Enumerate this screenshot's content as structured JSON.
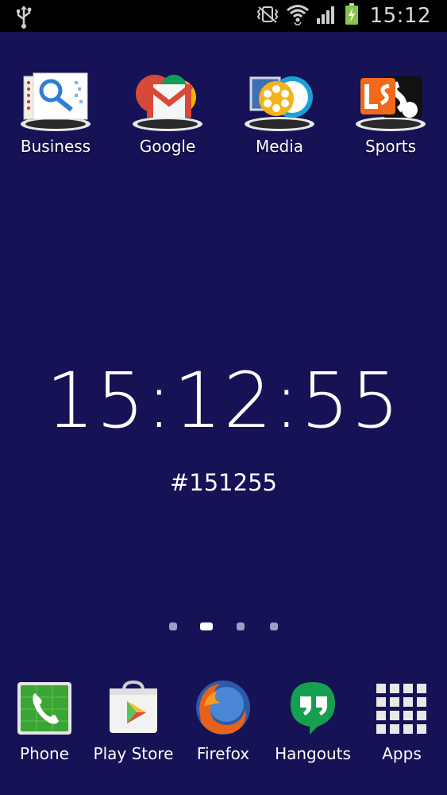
{
  "status_bar": {
    "time": "15:12",
    "icons": [
      "usb-icon",
      "vibrate-icon",
      "wifi-icon",
      "signal-icon",
      "battery-charging-icon"
    ],
    "battery_color": "#8bc34a"
  },
  "folders": [
    {
      "label": "Business",
      "icon": "business-folder-icon"
    },
    {
      "label": "Google",
      "icon": "google-folder-icon"
    },
    {
      "label": "Media",
      "icon": "media-folder-icon"
    },
    {
      "label": "Sports",
      "icon": "sports-folder-icon"
    }
  ],
  "clock_widget": {
    "time": "15:12:55",
    "hex_color": "#151255"
  },
  "page_indicator": {
    "count": 4,
    "active_index": 1
  },
  "dock": [
    {
      "label": "Phone",
      "icon": "phone-icon"
    },
    {
      "label": "Play Store",
      "icon": "play-store-icon"
    },
    {
      "label": "Firefox",
      "icon": "firefox-icon"
    },
    {
      "label": "Hangouts",
      "icon": "hangouts-icon"
    },
    {
      "label": "Apps",
      "icon": "apps-grid-icon"
    }
  ],
  "colors": {
    "wallpaper": "#151255",
    "status_bar": "#000000"
  }
}
